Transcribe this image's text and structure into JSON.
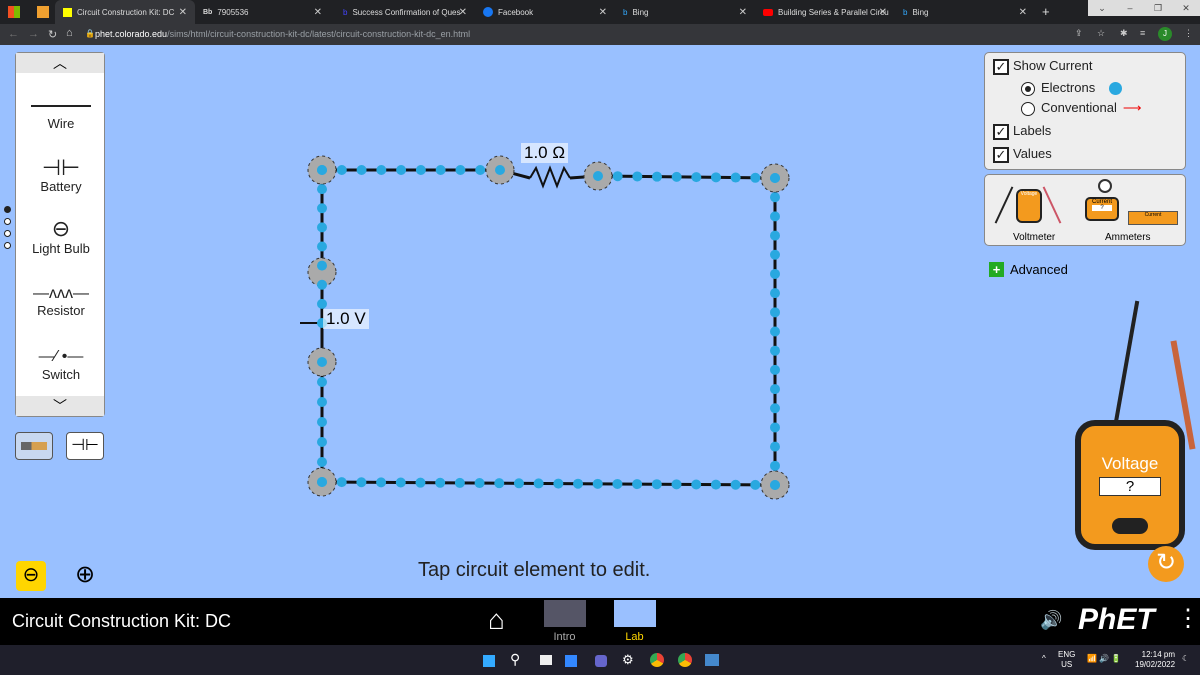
{
  "browser": {
    "tabs": [
      {
        "title": "Circuit Construction Kit: DC",
        "active": true
      },
      {
        "title": "7905536",
        "icon": "Bb"
      },
      {
        "title": "Success Confirmation of Ques"
      },
      {
        "title": "Facebook"
      },
      {
        "title": "Bing"
      },
      {
        "title": "Building Series & Parallel Circu"
      },
      {
        "title": "Bing"
      }
    ],
    "url_domain": "phet.colorado.edu",
    "url_path": "/sims/html/circuit-construction-kit-dc/latest/circuit-construction-kit-dc_en.html",
    "new_tab": "+",
    "profile_initial": "J"
  },
  "toolbox": {
    "items": [
      {
        "label": "Wire"
      },
      {
        "label": "Battery"
      },
      {
        "label": "Light Bulb"
      },
      {
        "label": "Resistor"
      },
      {
        "label": "Switch"
      }
    ]
  },
  "circuit": {
    "resistor_label": "1.0 Ω",
    "battery_label": "1.0 V"
  },
  "hint": "Tap circuit element to edit.",
  "controls": {
    "show_current": "Show Current",
    "show_current_checked": true,
    "electrons": "Electrons",
    "electrons_selected": true,
    "conventional": "Conventional",
    "labels": "Labels",
    "labels_checked": true,
    "values": "Values",
    "values_checked": true
  },
  "meters": {
    "voltmeter": "Voltmeter",
    "ammeters": "Ammeters",
    "voltmeter_tiny": "Voltage",
    "ammeter_tiny": "Current",
    "reading": "?"
  },
  "advanced": "Advanced",
  "big_voltmeter": {
    "title": "Voltage",
    "reading": "?"
  },
  "sim_title": "Circuit Construction Kit: DC",
  "screens": [
    {
      "label": "Intro"
    },
    {
      "label": "Lab",
      "selected": true
    }
  ],
  "phet_logo": "PhET",
  "taskbar": {
    "lang": "ENG",
    "region": "US",
    "time": "12:14 pm",
    "date": "19/02/2022"
  },
  "colors": {
    "sim_bg": "#99c0ff",
    "electron": "#29a8e0",
    "lab_selected": "#ffd500",
    "conventional_arrow": "#e00000"
  }
}
